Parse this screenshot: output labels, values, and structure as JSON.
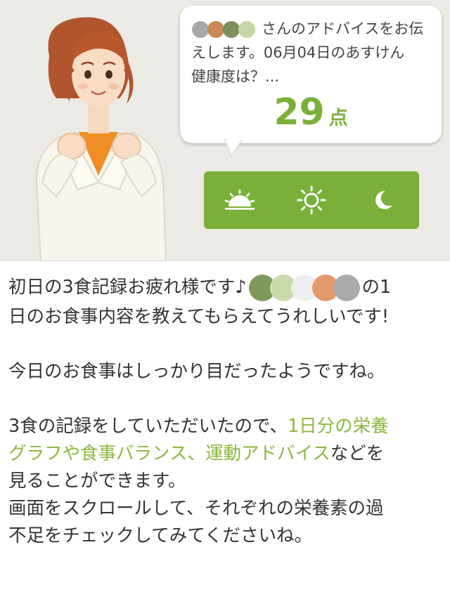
{
  "bubble": {
    "line1_suffix": "さんのアドバイスをお伝",
    "line2": "えします。06月04日のあすけん",
    "line3": "健康度は？...",
    "score": "29",
    "score_unit": "点",
    "masked_name_colors": [
      "#a7a8a6",
      "#c98a55",
      "#7d8f5a",
      "#c6d7a6"
    ]
  },
  "time_bar": {
    "background": "#7ab03a",
    "buttons": [
      {
        "icon": "sunrise-icon"
      },
      {
        "icon": "sun-icon"
      },
      {
        "icon": "moon-icon"
      }
    ]
  },
  "message": {
    "p1_line1_pre": "初日の3食記録お疲れ様です♪",
    "p1_line1_post": "の1",
    "p1_line2": "日のお食事内容を教えてもらえてうれしいです!",
    "masked_name_colors": [
      "#7d9a5a",
      "#c9dbab",
      "#eeeeee",
      "#e4996a",
      "#aaaaaa"
    ],
    "p2": "今日のお食事はしっかり目だったようですね。",
    "p3_line1_pre": "3食の記録をしていただいたので、",
    "p3_line1_hl": "1日分の栄養",
    "p3_line2_hl": "グラフや食事バランス、運動アドバイス",
    "p3_line2_post": "などを",
    "p3_line3": "見ることができます。",
    "p3_line4": "画面をスクロールして、それぞれの栄養素の過",
    "p3_line5": "不足をチェックしてみてくださいね。",
    "highlight_color": "#8bb83c"
  }
}
